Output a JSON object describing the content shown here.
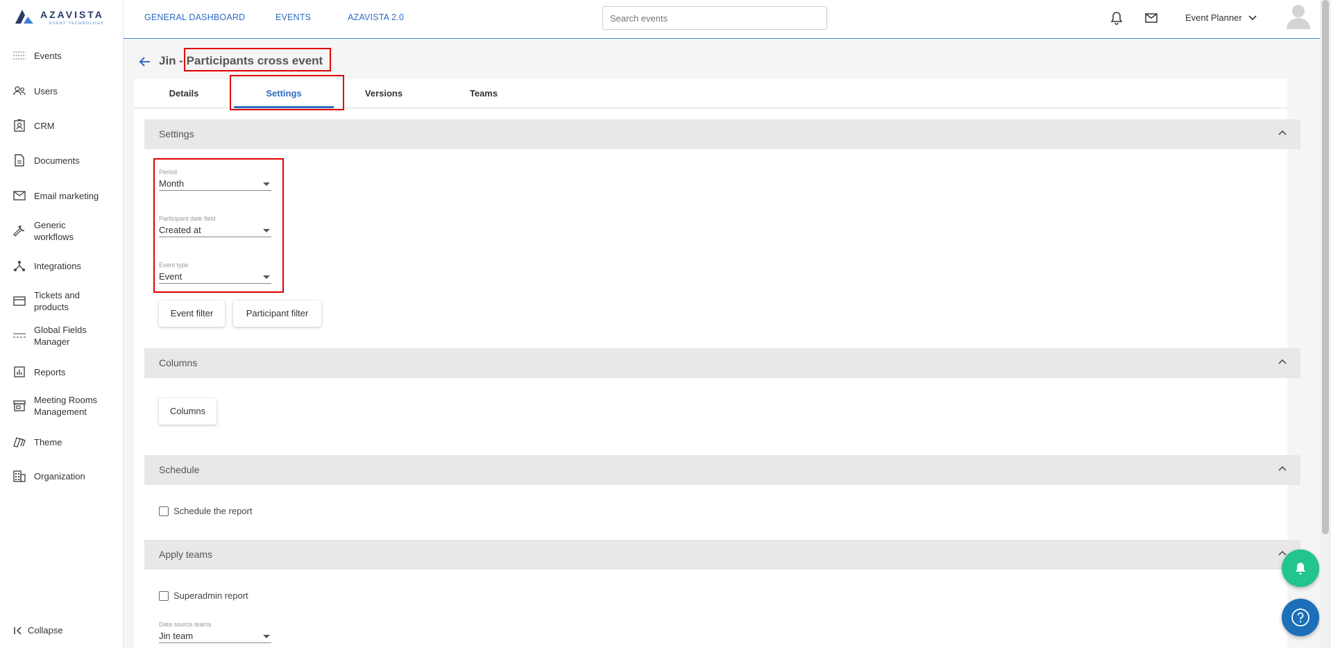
{
  "brand": {
    "name": "AZAVISTA",
    "tagline": "EVENT TECHNOLOGY"
  },
  "sidebar": {
    "items": [
      {
        "label": "Events",
        "icon": "events-list-icon"
      },
      {
        "label": "Users",
        "icon": "users-icon"
      },
      {
        "label": "CRM",
        "icon": "crm-contact-icon"
      },
      {
        "label": "Documents",
        "icon": "document-icon"
      },
      {
        "label": "Email marketing",
        "icon": "mail-icon"
      },
      {
        "label": "Generic workflows",
        "icon": "wrench-icon"
      },
      {
        "label": "Integrations",
        "icon": "integrations-icon"
      },
      {
        "label": "Tickets and products",
        "icon": "card-icon"
      },
      {
        "label": "Global Fields Manager",
        "icon": "fields-icon"
      },
      {
        "label": "Reports",
        "icon": "reports-icon"
      },
      {
        "label": "Meeting Rooms Management",
        "icon": "store-icon"
      },
      {
        "label": "Theme",
        "icon": "theme-icon"
      },
      {
        "label": "Organization",
        "icon": "organization-icon"
      }
    ],
    "collapse_label": "Collapse"
  },
  "topbar": {
    "links": [
      "GENERAL DASHBOARD",
      "EVENTS",
      "AZAVISTA 2.0"
    ],
    "search_placeholder": "Search events",
    "user_name": "Event Planner"
  },
  "page": {
    "title": "Jin - Participants cross event",
    "tabs": [
      {
        "label": "Details",
        "active": false
      },
      {
        "label": "Settings",
        "active": true
      },
      {
        "label": "Versions",
        "active": false
      },
      {
        "label": "Teams",
        "active": false
      }
    ]
  },
  "settings_section": {
    "title": "Settings",
    "fields": [
      {
        "label": "Period",
        "value": "Month"
      },
      {
        "label": "Participant date field",
        "value": "Created at"
      },
      {
        "label": "Event type",
        "value": "Event"
      }
    ],
    "buttons": {
      "event_filter": "Event filter",
      "participant_filter": "Participant filter"
    }
  },
  "columns_section": {
    "title": "Columns",
    "button": "Columns"
  },
  "schedule_section": {
    "title": "Schedule",
    "checkbox_label": "Schedule the report",
    "checked": false
  },
  "teams_section": {
    "title": "Apply teams",
    "checkbox_label": "Superadmin report",
    "checked": false,
    "data_source_label": "Data source teams",
    "data_source_value": "Jin team"
  },
  "colors": {
    "accent": "#2d6cc0",
    "highlight": "#e00000",
    "fab_green": "#22c58b",
    "fab_blue": "#1c6fb8"
  }
}
